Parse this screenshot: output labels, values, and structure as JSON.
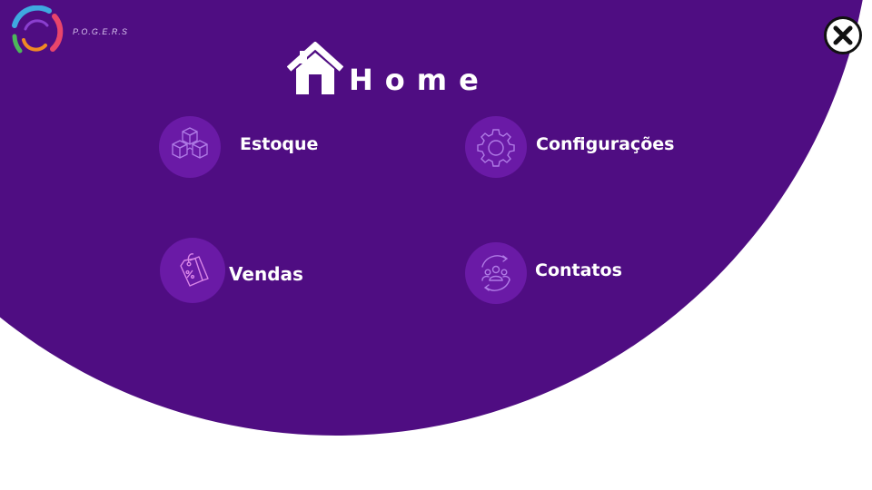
{
  "brand": {
    "name": "P.O.G.E.R.S",
    "logo_icon": "ring-logo-icon",
    "colors": [
      "#3fa9e0",
      "#e9456b",
      "#f08a24",
      "#4db85a",
      "#8a3fcf"
    ]
  },
  "header": {
    "title": "Home",
    "title_icon": "house-icon",
    "close_icon": "close-icon"
  },
  "theme": {
    "background": "#ffffff",
    "accent": "#4f0d82",
    "icon_circle": "#6a1aa6",
    "text": "#ffffff"
  },
  "menu": {
    "items": [
      {
        "label": "Estoque",
        "icon": "boxes-icon"
      },
      {
        "label": "Configurações",
        "icon": "gear-icon"
      },
      {
        "label": "Vendas",
        "icon": "price-tag-icon"
      },
      {
        "label": "Contatos",
        "icon": "people-icon"
      }
    ]
  }
}
